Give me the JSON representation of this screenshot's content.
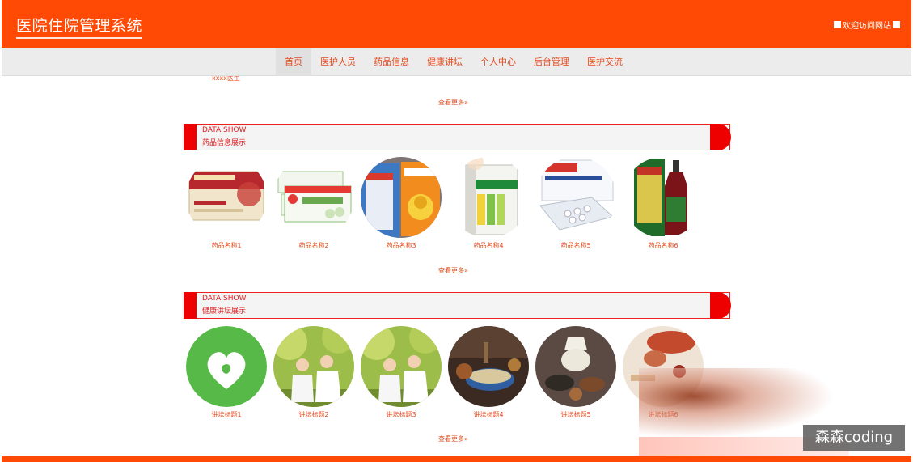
{
  "header": {
    "title": "医院住院管理系统",
    "welcome": "欢迎访问网站"
  },
  "nav": {
    "items": [
      {
        "label": "首页"
      },
      {
        "label": "医护人员"
      },
      {
        "label": "药品信息"
      },
      {
        "label": "健康讲坛"
      },
      {
        "label": "个人中心"
      },
      {
        "label": "后台管理"
      },
      {
        "label": "医护交流"
      }
    ]
  },
  "doctors": {
    "cut_name": "xxxx医生",
    "more": "查看更多»"
  },
  "drugs": {
    "title_en": "DATA SHOW",
    "title_cn": "药品信息展示",
    "items": [
      {
        "name": "药品名称1"
      },
      {
        "name": "药品名称2"
      },
      {
        "name": "药品名称3"
      },
      {
        "name": "药品名称4"
      },
      {
        "name": "药品名称5"
      },
      {
        "name": "药品名称6"
      }
    ],
    "more": "查看更多»"
  },
  "forum": {
    "title_en": "DATA SHOW",
    "title_cn": "健康讲坛展示",
    "items": [
      {
        "name": "讲坛标题1"
      },
      {
        "name": "讲坛标题2"
      },
      {
        "name": "讲坛标题3"
      },
      {
        "name": "讲坛标题4"
      },
      {
        "name": "讲坛标题5"
      },
      {
        "name": "讲坛标题6"
      }
    ],
    "more": "查看更多»"
  },
  "watermark": "森森coding",
  "colors": {
    "brand": "#ff4a05",
    "accent": "#ef0000",
    "text": "#e64b1e"
  }
}
